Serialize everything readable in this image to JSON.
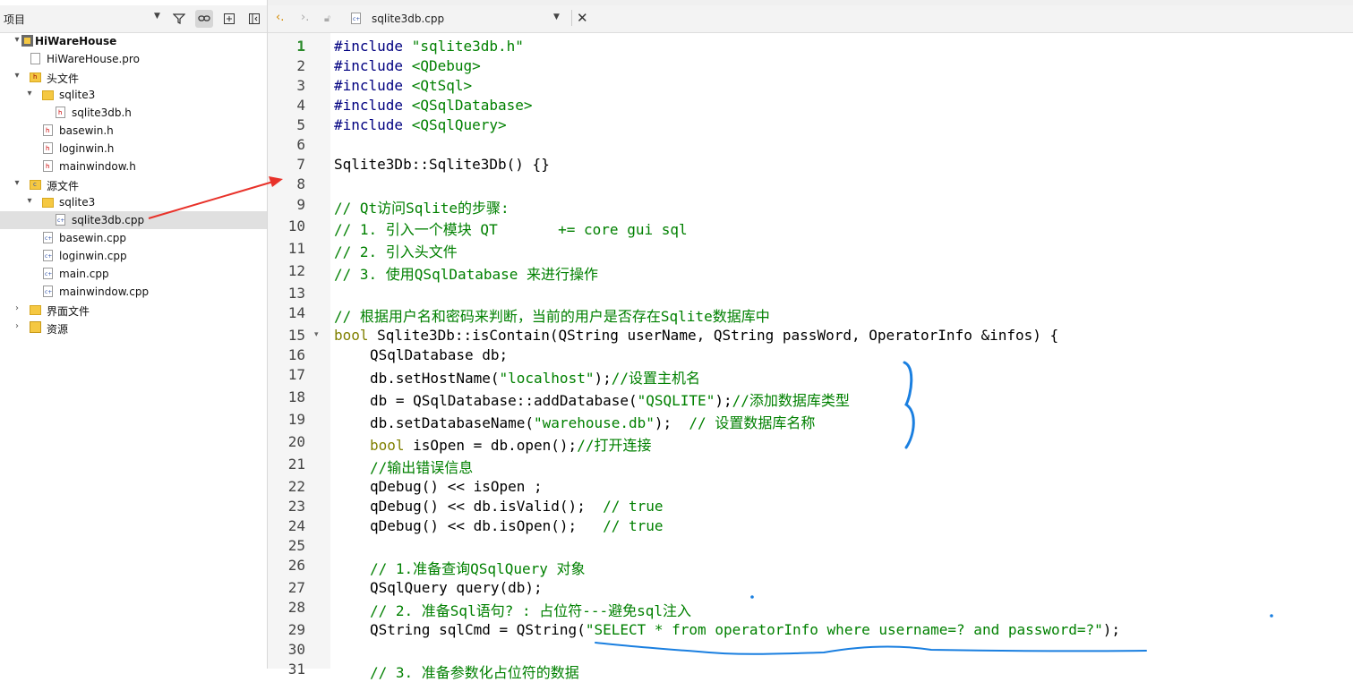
{
  "project_panel": {
    "title": "项目",
    "tree": [
      {
        "label": "HiWareHouse",
        "bold": true,
        "icon": "project-icon"
      },
      {
        "label": "HiWareHouse.pro",
        "icon": "pro-file-icon"
      },
      {
        "label": "头文件",
        "icon": "header-folder-icon"
      },
      {
        "label": "sqlite3",
        "icon": "folder-icon"
      },
      {
        "label": "sqlite3db.h",
        "icon": "header-file-icon"
      },
      {
        "label": "basewin.h",
        "icon": "header-file-icon"
      },
      {
        "label": "loginwin.h",
        "icon": "header-file-icon"
      },
      {
        "label": "mainwindow.h",
        "icon": "header-file-icon"
      },
      {
        "label": "源文件",
        "icon": "source-folder-icon"
      },
      {
        "label": "sqlite3",
        "icon": "folder-icon"
      },
      {
        "label": "sqlite3db.cpp",
        "icon": "cpp-file-icon",
        "selected": true
      },
      {
        "label": "basewin.cpp",
        "icon": "cpp-file-icon"
      },
      {
        "label": "loginwin.cpp",
        "icon": "cpp-file-icon"
      },
      {
        "label": "main.cpp",
        "icon": "cpp-file-icon"
      },
      {
        "label": "mainwindow.cpp",
        "icon": "cpp-file-icon"
      },
      {
        "label": "界面文件",
        "icon": "forms-folder-icon"
      },
      {
        "label": "资源",
        "icon": "resources-folder-icon"
      }
    ]
  },
  "editor": {
    "file_name": "sqlite3db.cpp",
    "current_line": "1",
    "line_numbers": [
      "1",
      "2",
      "3",
      "4",
      "5",
      "6",
      "7",
      "8",
      "9",
      "10",
      "11",
      "12",
      "13",
      "14",
      "15",
      "16",
      "17",
      "18",
      "19",
      "20",
      "21",
      "22",
      "23",
      "24",
      "25",
      "26",
      "27",
      "28",
      "29",
      "30",
      "31"
    ],
    "lines": [
      "#include \"sqlite3db.h\"",
      "#include <QDebug>",
      "#include <QtSql>",
      "#include <QSqlDatabase>",
      "#include <QSqlQuery>",
      "",
      "Sqlite3Db::Sqlite3Db() {}",
      "",
      "// Qt访问Sqlite的步骤:",
      "// 1. 引入一个模块 QT       += core gui sql",
      "// 2. 引入头文件",
      "// 3. 使用QSqlDatabase 来进行操作",
      "",
      "// 根据用户名和密码来判断，当前的用户是否存在Sqlite数据库中",
      "bool Sqlite3Db::isContain(QString userName, QString passWord, OperatorInfo &infos) {",
      "QSqlDatabase db;",
      "db.setHostName(\"localhost\");//设置主机名",
      "db = QSqlDatabase::addDatabase(\"QSQLITE\");//添加数据库类型",
      "db.setDatabaseName(\"warehouse.db\");  // 设置数据库名称",
      "bool isOpen = db.open();//打开连接",
      "//输出错误信息",
      "qDebug() << isOpen ;",
      "qDebug() << db.isValid();  // true",
      "qDebug() << db.isOpen();   // true",
      "",
      "// 1.准备查询QSqlQuery 对象",
      "QSqlQuery query(db);",
      "// 2. 准备Sql语句? : 占位符---避免sql注入",
      "QString sqlCmd = QString(\"SELECT * from operatorInfo where username=? and password=?\");",
      "",
      "// 3. 准备参数化占位符的数据"
    ]
  },
  "colors": {
    "keyword": "#808000",
    "preprocessor": "#000080",
    "string": "#008000",
    "comment": "#008000",
    "annotation_red": "#e8322a",
    "annotation_blue": "#1a7fe0"
  }
}
